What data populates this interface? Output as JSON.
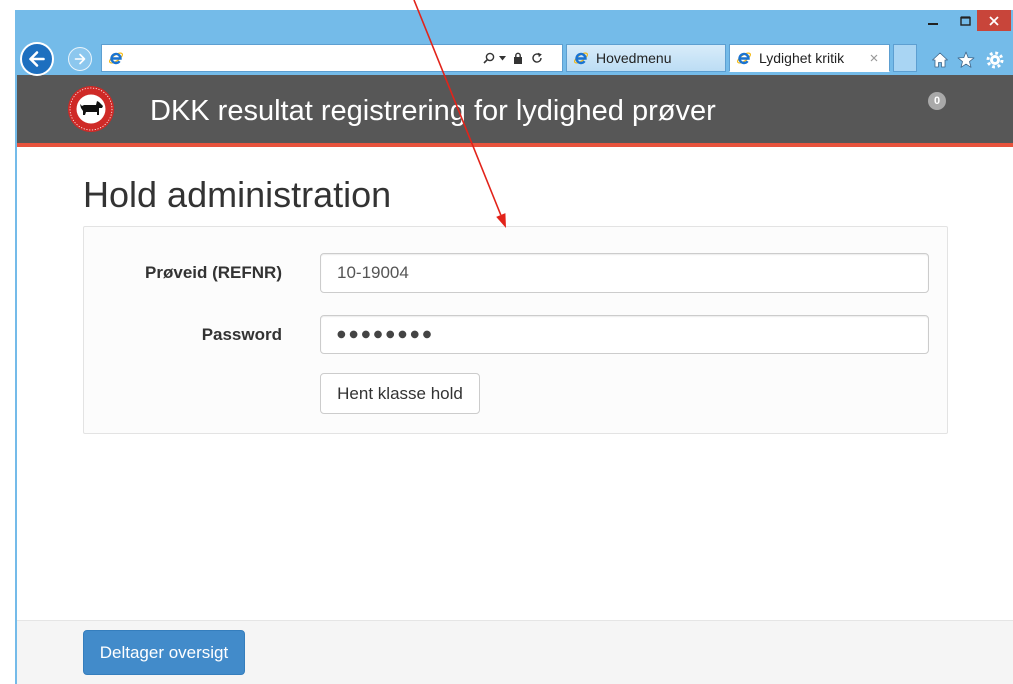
{
  "colors": {
    "frame": "#74bbe9",
    "close": "#c8453a",
    "header": "#575757",
    "header-border": "#e8533d",
    "primary": "#428bca",
    "annotation": "#e2231a"
  },
  "browser": {
    "window_controls": [
      "minimize-icon",
      "maximize-icon",
      "close-icon"
    ],
    "navigation": {
      "back_icon": "back-arrow-icon",
      "forward_icon": "forward-arrow-icon"
    },
    "address_bar": {
      "site_icon": "ie-icon",
      "icons": [
        "search-icon",
        "dropdown-icon",
        "lock-icon",
        "refresh-icon"
      ]
    },
    "tabs": [
      {
        "label": "Hovedmenu",
        "icon": "ie-icon",
        "active": false
      },
      {
        "label": "Lydighet kritik",
        "icon": "ie-icon",
        "active": true,
        "close_icon": "close-icon"
      }
    ],
    "toolbar_icons": [
      "home-icon",
      "star-icon",
      "gear-icon"
    ]
  },
  "header": {
    "logo": "dkk-logo",
    "title": "DKK resultat registrering for lydighed prøver",
    "badge": "0"
  },
  "main": {
    "title": "Hold administration",
    "form": {
      "refnr": {
        "label": "Prøveid (REFNR)",
        "value": "10-19004"
      },
      "password": {
        "label": "Password",
        "value": "●●●●●●●●"
      },
      "submit_label": "Hent klasse hold"
    }
  },
  "footer": {
    "button_label": "Deltager oversigt"
  }
}
